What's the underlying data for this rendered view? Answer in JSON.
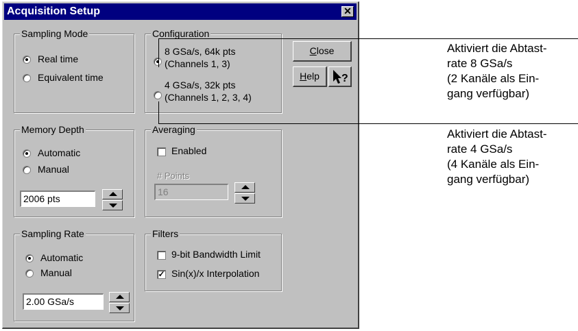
{
  "window": {
    "title": "Acquisition Setup"
  },
  "sampling_mode": {
    "label": "Sampling Mode",
    "options": [
      "Real time",
      "Equivalent time"
    ],
    "selected": "Real time"
  },
  "configuration": {
    "label": "Configuration",
    "option1": {
      "line1": "8 GSa/s, 64k pts",
      "line2": "(Channels 1, 3)"
    },
    "option2": {
      "line1": "4 GSa/s, 32k pts",
      "line2": "(Channels 1, 2, 3, 4)"
    },
    "selected": "option1"
  },
  "buttons": {
    "close": "Close",
    "help": "Help",
    "whatsthis": "?"
  },
  "memory_depth": {
    "label": "Memory Depth",
    "options": [
      "Automatic",
      "Manual"
    ],
    "selected": "Automatic",
    "value": "2006 pts"
  },
  "averaging": {
    "label": "Averaging",
    "enabled_label": "Enabled",
    "enabled": false,
    "points_label": "# Points",
    "points_value": "16"
  },
  "sampling_rate": {
    "label": "Sampling Rate",
    "options": [
      "Automatic",
      "Manual"
    ],
    "selected": "Automatic",
    "value": "2.00 GSa/s"
  },
  "filters": {
    "label": "Filters",
    "bandwidth_label": "9-bit Bandwidth Limit",
    "bandwidth_checked": false,
    "sinx_label": "Sin(x)/x Interpolation",
    "sinx_checked": true
  },
  "annotations": [
    {
      "lines": [
        "Aktiviert die Abtast-",
        "rate 8 GSa/s",
        "(2 Kanäle als Ein-",
        "gang verfügbar)"
      ]
    },
    {
      "lines": [
        "Aktiviert die Abtast-",
        "rate 4 GSa/s",
        "(4 Kanäle als Ein-",
        "gang verfügbar)"
      ]
    }
  ]
}
